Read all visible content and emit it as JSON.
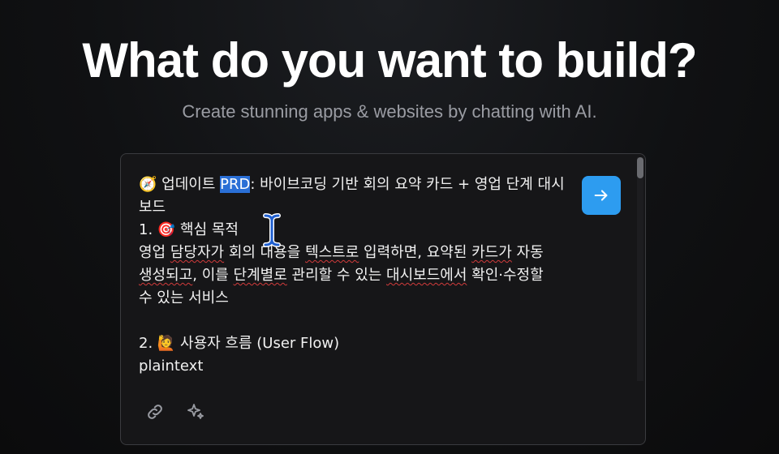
{
  "hero": {
    "title": "What do you want to build?",
    "subtitle": "Create stunning apps & websites by chatting with AI."
  },
  "prompt": {
    "line1_icon": "🧭",
    "line1_prefix": " 업데이트 ",
    "line1_selected": "PRD",
    "line1_rest": ": 바이브코딩 기반 회의 요약 카드 + 영업 단계 대시보드",
    "l2": "1. 🎯 핵심 목적",
    "l3a": "영업 ",
    "l3b": "담당자가",
    "l3c": " 회의 대용을 ",
    "l3d": "텍스트로",
    "l3e": " 입력하면, 요약된 ",
    "l3f": "카드가",
    "l3g": " 자동",
    "l4a": "생성되고",
    "l4b": ", 이를 ",
    "l4c": "단계별로",
    "l4d": " 관리할 수 있는 ",
    "l4e": "대시보드에서",
    "l4f": " 확인·수정할",
    "l5": "수 있는 서비스",
    "l6": "2. 🙋 사용자 흐름 (User Flow)",
    "l7": "plaintext"
  },
  "icons": {
    "send": "arrow-right-icon",
    "attach": "link-icon",
    "enhance": "sparkles-icon"
  },
  "colors": {
    "accent": "#2d9cf0",
    "selection": "#2a6fd6"
  }
}
